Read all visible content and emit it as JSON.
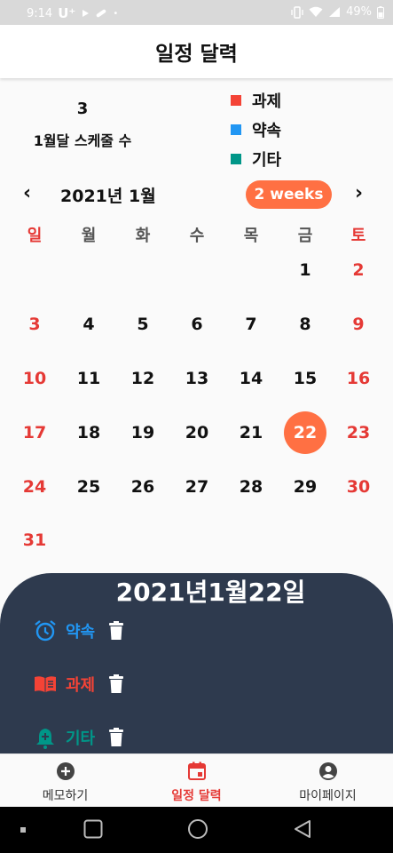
{
  "status_bar": {
    "time": "9:14",
    "carrier": "U⁺",
    "battery": "49%"
  },
  "header": {
    "title": "일정 달력"
  },
  "summary": {
    "count": "3",
    "label": "1월달 스케줄 수"
  },
  "legend": [
    {
      "label": "과제",
      "color": "#f44336"
    },
    {
      "label": "약속",
      "color": "#2196f3"
    },
    {
      "label": "기타",
      "color": "#009688"
    }
  ],
  "calendar": {
    "prev": "‹",
    "next": "›",
    "month_title": "2021년 1월",
    "format_button": "2 weeks",
    "weekdays": [
      "일",
      "월",
      "화",
      "수",
      "목",
      "금",
      "토"
    ],
    "weeks": [
      [
        "",
        "",
        "",
        "",
        "",
        "1",
        "2"
      ],
      [
        "3",
        "4",
        "5",
        "6",
        "7",
        "8",
        "9"
      ],
      [
        "10",
        "11",
        "12",
        "13",
        "14",
        "15",
        "16"
      ],
      [
        "17",
        "18",
        "19",
        "20",
        "21",
        "22",
        "23"
      ],
      [
        "24",
        "25",
        "26",
        "27",
        "28",
        "29",
        "30"
      ],
      [
        "31",
        "",
        "",
        "",
        "",
        "",
        ""
      ]
    ],
    "selected_day": "22"
  },
  "sheet": {
    "date": "2021년1월22일",
    "events": [
      {
        "label": "약속",
        "color": "#2196f3",
        "icon": "alarm-icon"
      },
      {
        "label": "과제",
        "color": "#f44336",
        "icon": "book-icon"
      },
      {
        "label": "기타",
        "color": "#009688",
        "icon": "bell-plus-icon"
      }
    ]
  },
  "bottom_nav": [
    {
      "label": "메모하기",
      "icon": "add-circle-icon",
      "active": false
    },
    {
      "label": "일정 달력",
      "icon": "calendar-icon",
      "active": true
    },
    {
      "label": "마이페이지",
      "icon": "account-circle-icon",
      "active": false
    }
  ],
  "colors": {
    "accent": "#ff7043",
    "sunday_saturday": "#e53935",
    "sheet_bg": "#2e3a4e"
  }
}
